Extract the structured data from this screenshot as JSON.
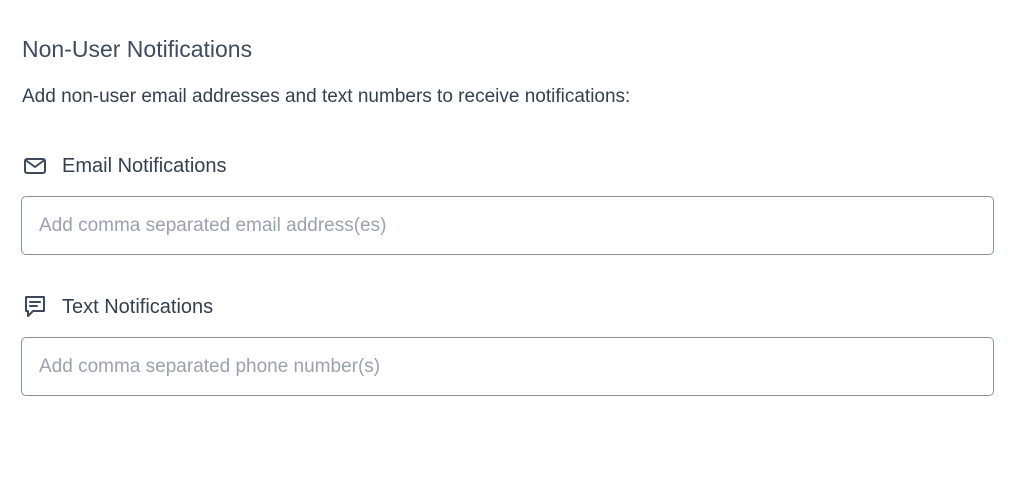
{
  "section": {
    "title": "Non-User Notifications",
    "description": "Add non-user email addresses and text numbers to receive notifications:"
  },
  "email": {
    "icon": "envelope-icon",
    "label": "Email Notifications",
    "placeholder": "Add comma separated email address(es)",
    "value": ""
  },
  "text": {
    "icon": "chat-message-icon",
    "label": "Text Notifications",
    "placeholder": "Add comma separated phone number(s)",
    "value": ""
  },
  "colors": {
    "text_primary": "#34404f",
    "placeholder": "#9aa2ae",
    "border": "#8a93a3",
    "background": "#ffffff"
  }
}
